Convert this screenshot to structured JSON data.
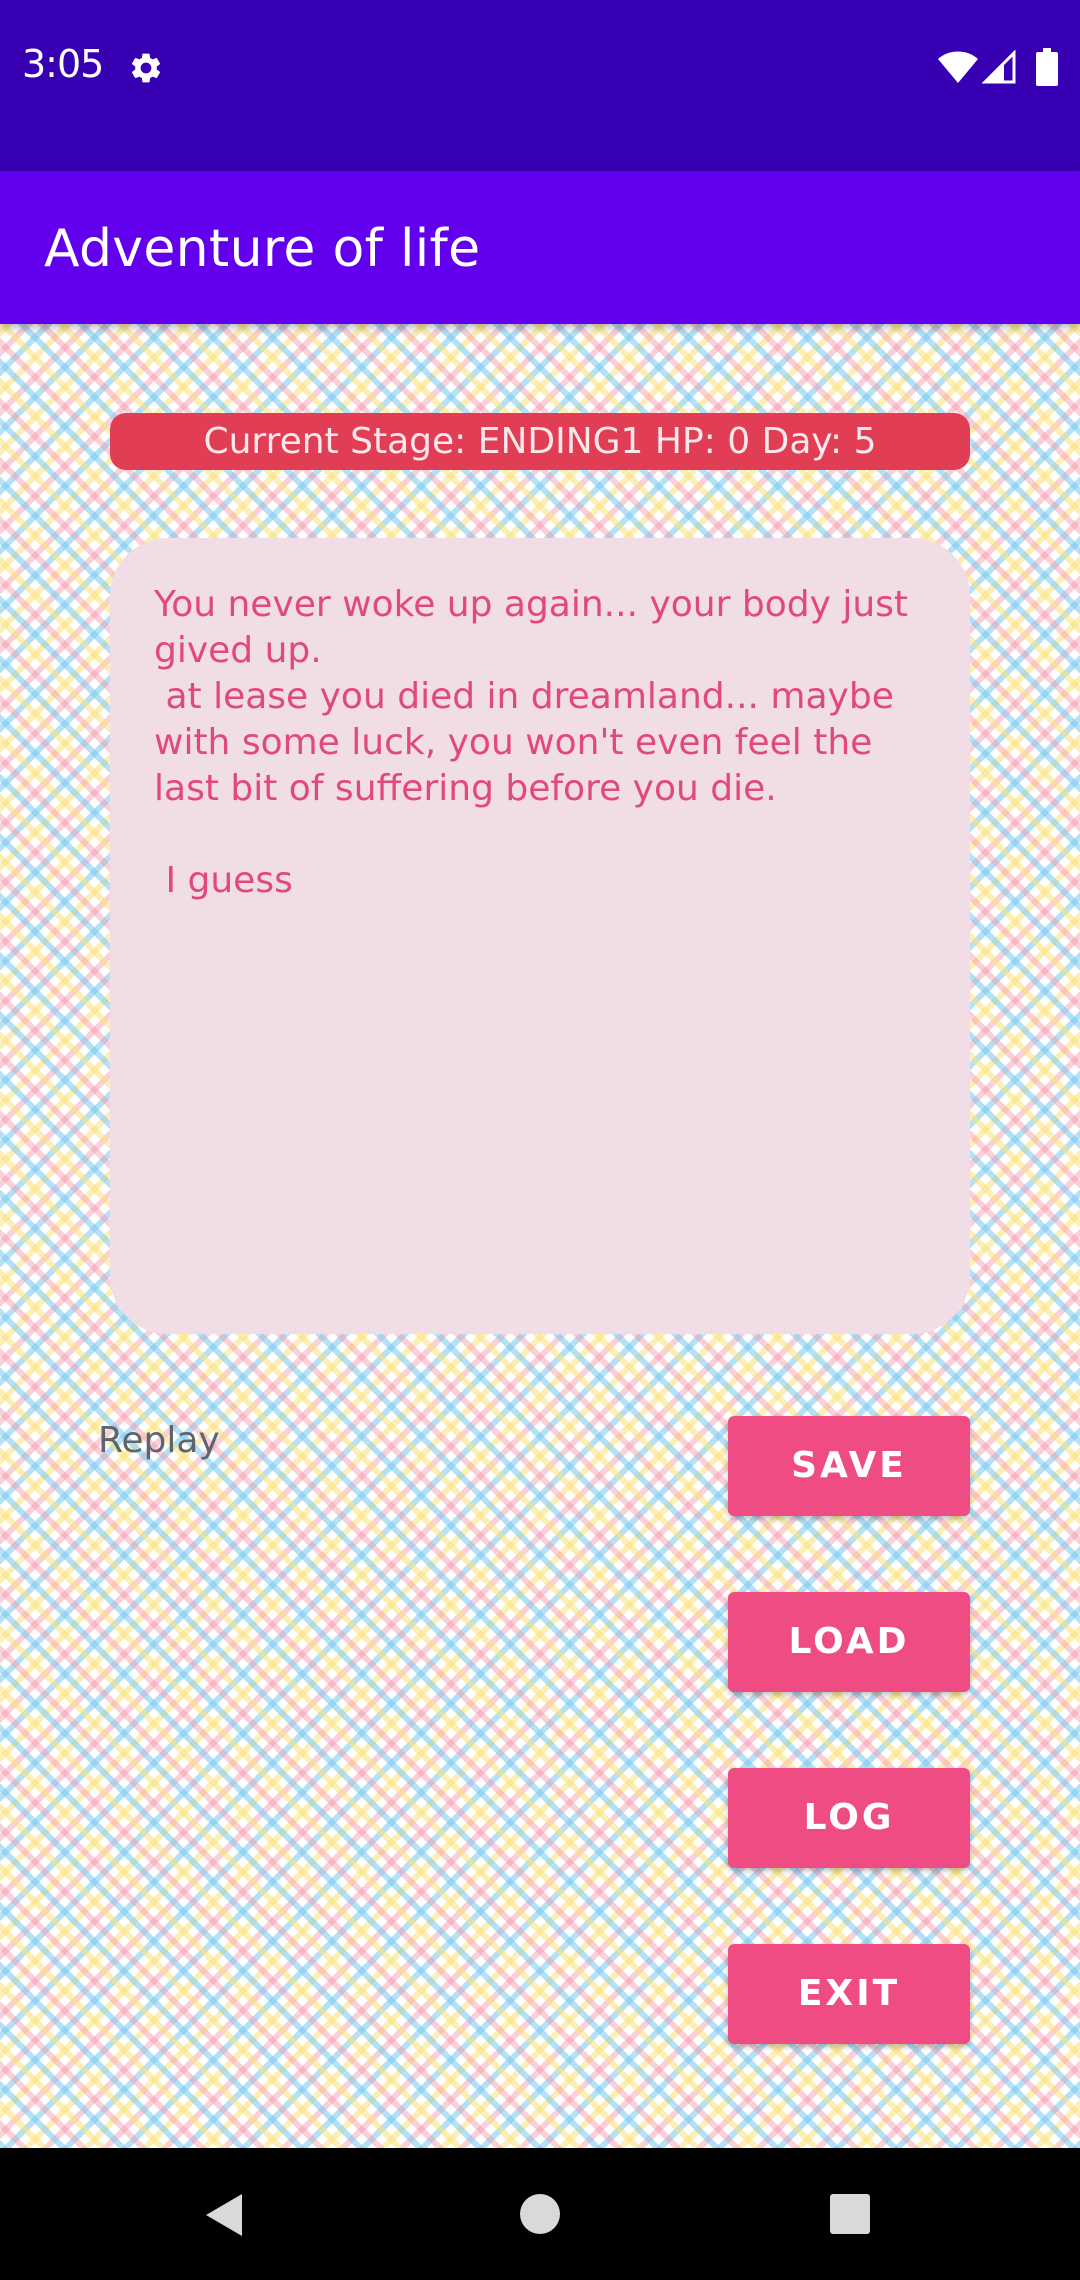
{
  "status_bar": {
    "time": "3:05",
    "icons": [
      "settings-icon",
      "wifi-icon",
      "cell-signal-icon",
      "battery-icon"
    ]
  },
  "app_bar": {
    "title": "Adventure of life"
  },
  "stage_banner": {
    "text": "Current Stage: ENDING1 HP: 0 Day: 5"
  },
  "story": {
    "text": "You never woke up again... your body just gived up.\n at lease you died in dreamland... maybe with some luck, you won't even feel the last bit of suffering before you die.\n\n I guess"
  },
  "actions": {
    "replay_label": "Replay",
    "save_label": "SAVE",
    "load_label": "LOAD",
    "log_label": "LOG",
    "exit_label": "EXIT"
  },
  "nav_bar": {
    "icons": [
      "back-icon",
      "home-icon",
      "recents-icon"
    ]
  },
  "colors": {
    "status_bar": "#3700b3",
    "app_bar": "#6200ee",
    "banner": "#e13d55",
    "panel": "#f1dde6",
    "story_text": "#e2497b",
    "button": "#ee4c82"
  }
}
